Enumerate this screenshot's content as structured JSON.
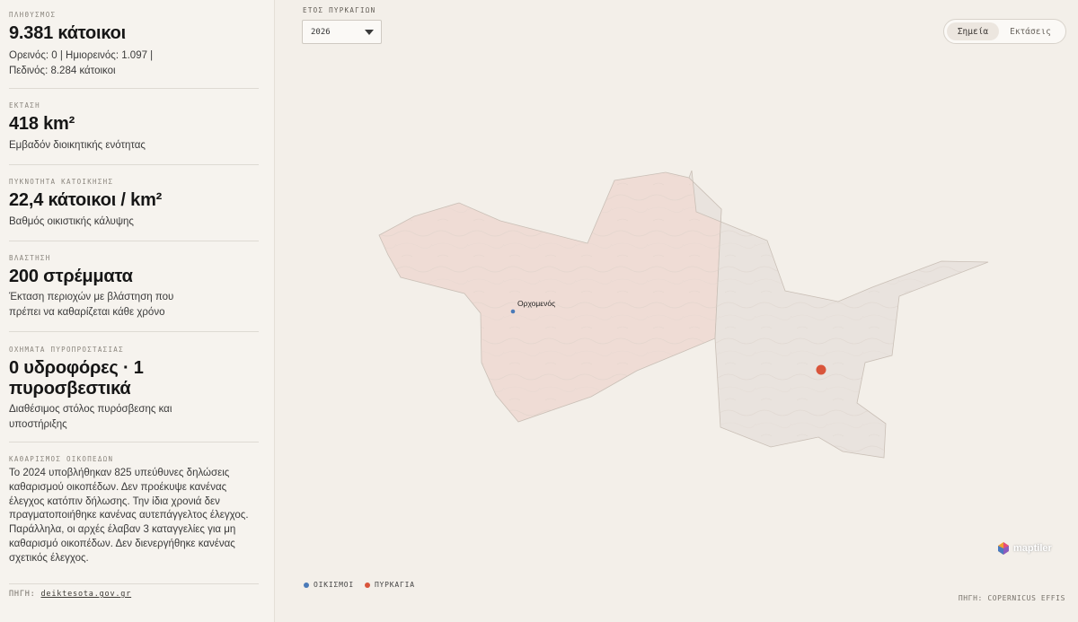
{
  "sidebar": {
    "population": {
      "label": "ΠΛΗΘΥΣΜΟΣ",
      "value": "9.381 κάτοικοι",
      "desc_line1": "Ορεινός: 0 | Ημιορεινός: 1.097 |",
      "desc_line2": "Πεδινός: 8.284 κάτοικοι"
    },
    "area": {
      "label": "ΕΚΤΑΣΗ",
      "value": "418 km²",
      "desc": "Εμβαδόν διοικητικής ενότητας"
    },
    "density": {
      "label": "ΠΥΚΝΟΤΗΤΑ ΚΑΤΟΙΚΗΣΗΣ",
      "value": "22,4 κάτοικοι / km²",
      "desc": "Βαθμός οικιστικής κάλυψης"
    },
    "vegetation": {
      "label": "ΒΛΑΣΤΗΣΗ",
      "value": "200 στρέμματα",
      "desc_line1": "Έκταση περιοχών με βλάστηση που",
      "desc_line2": "πρέπει να καθαρίζεται κάθε χρόνο"
    },
    "vehicles": {
      "label": "ΟΧΗΜΑΤΑ ΠΥΡΟΠΡΟΣΤΑΣΙΑΣ",
      "value_line1": "0 υδροφόρες · 1",
      "value_line2": "πυροσβεστικά",
      "desc_line1": "Διαθέσιμος στόλος πυρόσβεσης και",
      "desc_line2": "υποστήριξης"
    },
    "clearing": {
      "label": "ΚΑΘΑΡΙΣΜΟΣ ΟΙΚΟΠΕΔΩΝ",
      "lines": [
        "Το 2024 υποβλήθηκαν 825 υπεύθυνες δηλώσεις",
        "καθαρισμού οικοπέδων. Δεν προέκυψε κανένας",
        "έλεγχος κατόπιν δήλωσης. Την ίδια χρονιά δεν",
        "πραγματοποιήθηκε κανένας αυτεπάγγελτος έλεγχος.",
        "Παράλληλα, οι αρχές έλαβαν 3 καταγγελίες για μη",
        "καθαρισμό οικοπέδων. Δεν διενεργήθηκε κανένας",
        "σχετικός έλεγχος."
      ]
    },
    "source": {
      "label": "ΠΗΓΗ:",
      "link": "deiktesota.gov.gr"
    }
  },
  "map": {
    "year_label": "ΕΤΟΣ ΠΥΡΚΑΓΙΩΝ",
    "year_value": "2026",
    "toggle": {
      "active": "Σημεία",
      "other": "Εκτάσεις"
    },
    "town": "Ορχομενός",
    "legend": {
      "settlements": "ΟΙΚΙΣΜΟΙ",
      "fires": "ΠΥΡΚΑΓΙΑ"
    },
    "source": "ΠΗΓΗ: COPERNICUS EFFIS",
    "attribution": "maptiler",
    "colors": {
      "settlement": "#4a7ab8",
      "fire": "#d9553b",
      "region_west": "#efd9d3",
      "region_east": "#e9e3de"
    }
  }
}
